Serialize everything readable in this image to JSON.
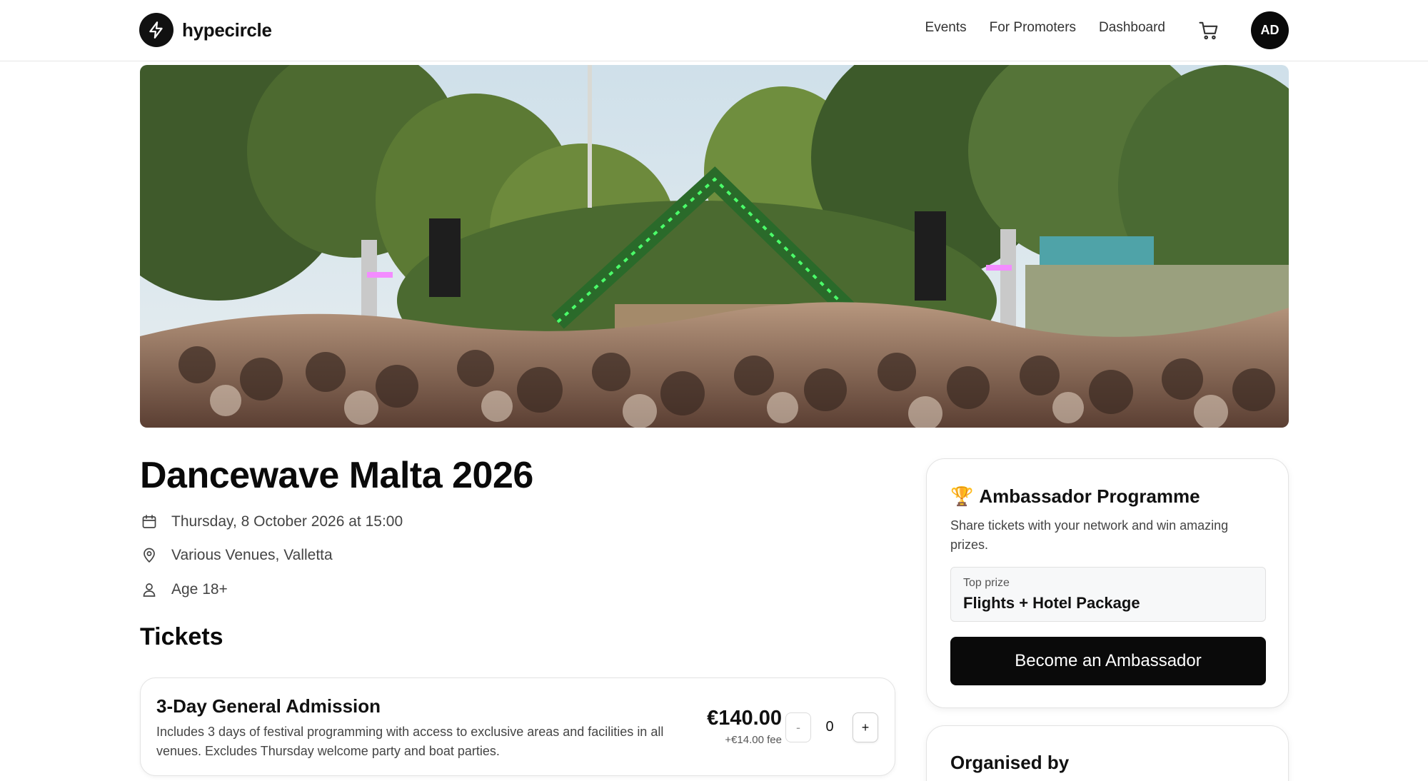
{
  "header": {
    "brand": "hypecircle",
    "nav": [
      {
        "label": "Events"
      },
      {
        "label": "For Promoters"
      },
      {
        "label": "Dashboard"
      }
    ],
    "avatar_initials": "AD",
    "cart_icon": "shopping-cart-icon",
    "logo_icon": "lightning-bolt-icon"
  },
  "event": {
    "title": "Dancewave Malta 2026",
    "date": "Thursday, 8 October 2026 at 15:00",
    "venue": "Various Venues, Valletta",
    "age": "Age 18+",
    "hero_description": "outdoor festival crowd in front of DJ stage with green lights and trees"
  },
  "tickets": {
    "heading": "Tickets",
    "items": [
      {
        "name": "3-Day General Admission",
        "description": "Includes 3 days of festival programming with access to exclusive areas and facilities in all venues. Excludes Thursday welcome party and boat parties.",
        "price": "€140.00",
        "fee": "+€14.00 fee",
        "quantity": "0",
        "minus": "-",
        "plus": "+"
      }
    ]
  },
  "ambassador": {
    "emoji": "🏆",
    "title": "Ambassador Programme",
    "description": "Share tickets with your network and win amazing prizes.",
    "prize_label": "Top prize",
    "prize_value": "Flights + Hotel Package",
    "button_label": "Become an Ambassador"
  },
  "organiser": {
    "title": "Organised by"
  },
  "colors": {
    "primary": "#0a0a0a",
    "border": "#e3e3e3",
    "text_muted": "#444444"
  }
}
